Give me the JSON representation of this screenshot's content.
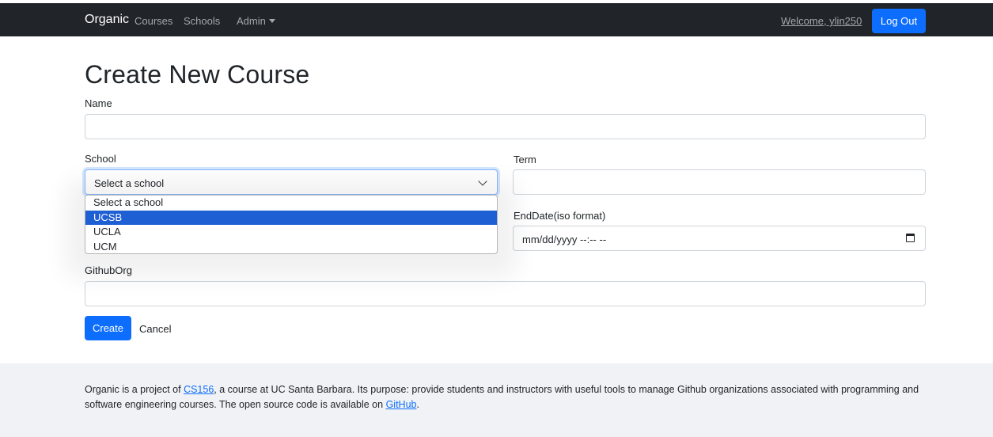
{
  "navbar": {
    "brand": "Organic",
    "links": {
      "courses": "Courses",
      "schools": "Schools",
      "admin": "Admin"
    },
    "welcome": "Welcome, ylin250",
    "logout_label": "Log Out"
  },
  "page": {
    "title": "Create New Course"
  },
  "form": {
    "name_label": "Name",
    "name_value": "",
    "school_label": "School",
    "school_selected": "Select a school",
    "school_options": [
      "Select a school",
      "UCSB",
      "UCLA",
      "UCM"
    ],
    "school_highlighted": "UCSB",
    "term_label": "Term",
    "term_value": "",
    "enddate_label": "EndDate(iso format)",
    "enddate_placeholder": "mm/dd/yyyy --:-- --",
    "githuborg_label": "GithubOrg",
    "githuborg_value": "",
    "create_label": "Create",
    "cancel_label": "Cancel"
  },
  "footer": {
    "part1": "Organic is a project of ",
    "cs156_link": "CS156",
    "part2": ", a course at UC Santa Barbara. Its purpose: provide students and instructors with useful tools to manage Github organizations associated with programming and software engineering courses. The open source code is available on ",
    "github_link": "GitHub",
    "part3": "."
  },
  "colors": {
    "navbar_bg": "#212529",
    "primary": "#0d6efd",
    "option_highlight": "#1e5fd4",
    "footer_bg": "#f1f2f5"
  }
}
